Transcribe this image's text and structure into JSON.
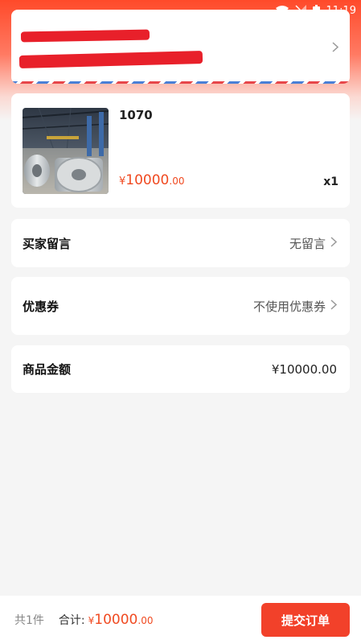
{
  "status_bar": {
    "time": "11:19"
  },
  "product": {
    "name": "1070",
    "price_symbol": "¥",
    "price_int": "10000",
    "price_dec": ".00",
    "quantity": "x1"
  },
  "buyer_message": {
    "label": "买家留言",
    "value": "无留言"
  },
  "coupon": {
    "label": "优惠券",
    "value": "不使用优惠券"
  },
  "goods_amount": {
    "label": "商品金额",
    "value": "¥10000.00"
  },
  "bottom_bar": {
    "count_text": "共1件",
    "total_label": "合计:",
    "price_symbol": "¥",
    "price_int": "10000",
    "price_dec": ".00",
    "submit_label": "提交订单"
  },
  "colors": {
    "accent": "#f04a21",
    "header_gradient_top": "#ff4a2a",
    "background": "#f5f5f5"
  }
}
